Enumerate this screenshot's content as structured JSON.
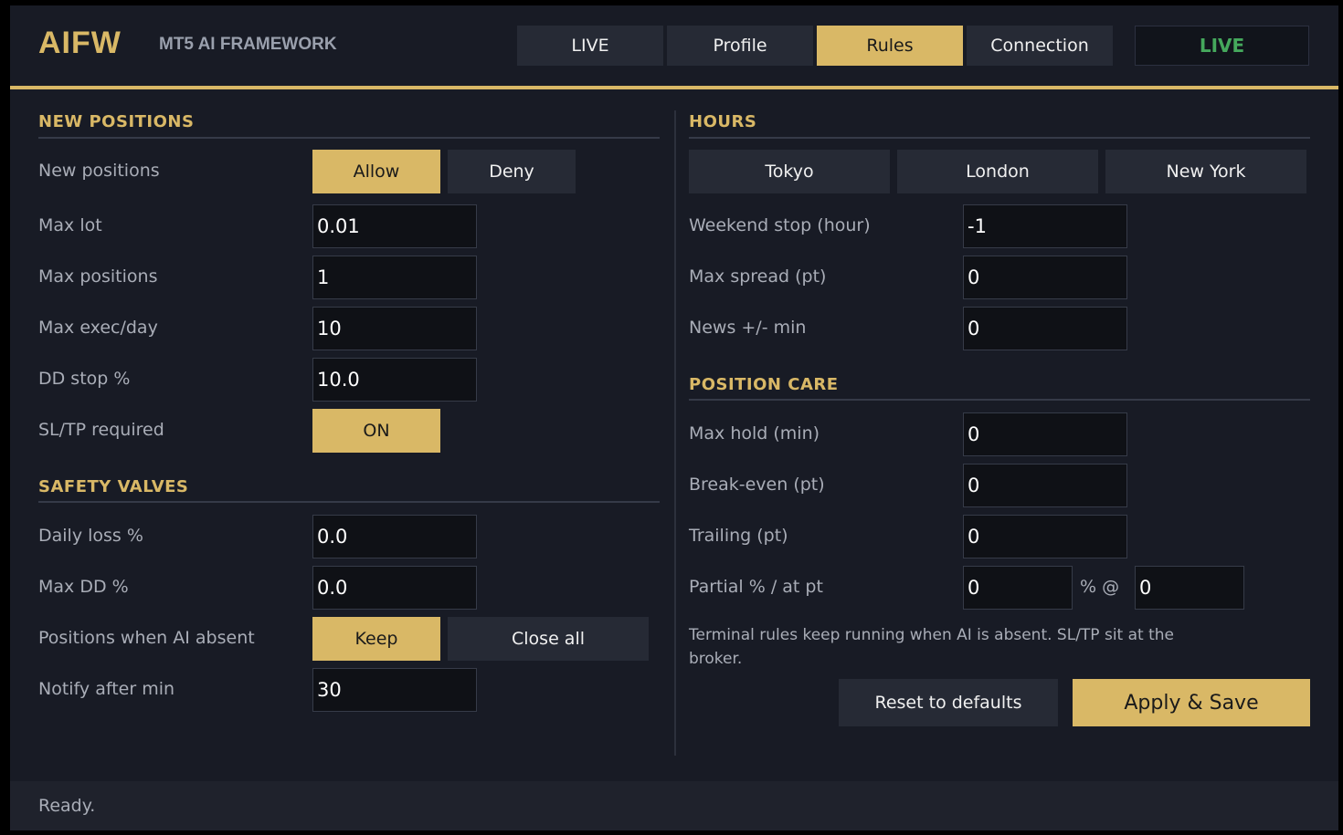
{
  "header": {
    "logo": "AIFW",
    "subtitle": "MT5 AI FRAMEWORK",
    "tabs": [
      "LIVE",
      "Profile",
      "Rules",
      "Connection"
    ],
    "active_tab": "Rules",
    "status_badge": "LIVE"
  },
  "new_positions": {
    "title": "NEW POSITIONS",
    "new_positions_label": "New positions",
    "allow_label": "Allow",
    "deny_label": "Deny",
    "max_lot_label": "Max lot",
    "max_lot_value": "0.01",
    "max_positions_label": "Max positions",
    "max_positions_value": "1",
    "max_exec_label": "Max exec/day",
    "max_exec_value": "10",
    "dd_stop_label": "DD stop %",
    "dd_stop_value": "10.0",
    "sltp_label": "SL/TP required",
    "sltp_value": "ON"
  },
  "safety_valves": {
    "title": "SAFETY VALVES",
    "daily_loss_label": "Daily loss %",
    "daily_loss_value": "0.0",
    "max_dd_label": "Max DD %",
    "max_dd_value": "0.0",
    "ai_absent_label": "Positions when AI absent",
    "keep_label": "Keep",
    "close_all_label": "Close all",
    "notify_label": "Notify after min",
    "notify_value": "30"
  },
  "hours": {
    "title": "HOURS",
    "sessions": [
      "Tokyo",
      "London",
      "New York"
    ],
    "weekend_stop_label": "Weekend stop (hour)",
    "weekend_stop_value": "-1",
    "max_spread_label": "Max spread (pt)",
    "max_spread_value": "0",
    "news_label": "News +/- min",
    "news_value": "0"
  },
  "position_care": {
    "title": "POSITION CARE",
    "max_hold_label": "Max hold (min)",
    "max_hold_value": "0",
    "break_even_label": "Break-even (pt)",
    "break_even_value": "0",
    "trailing_label": "Trailing (pt)",
    "trailing_value": "0",
    "partial_label": "Partial % / at pt",
    "partial_pct_value": "0",
    "partial_sep": "% @",
    "partial_pt_value": "0",
    "note": "Terminal rules keep running when AI is absent. SL/TP sit at the broker."
  },
  "actions": {
    "reset_label": "Reset to defaults",
    "apply_label": "Apply & Save"
  },
  "status_text": "Ready.",
  "colors": {
    "accent": "#d9b866",
    "background": "#181b25",
    "live_green": "#45a85c"
  }
}
